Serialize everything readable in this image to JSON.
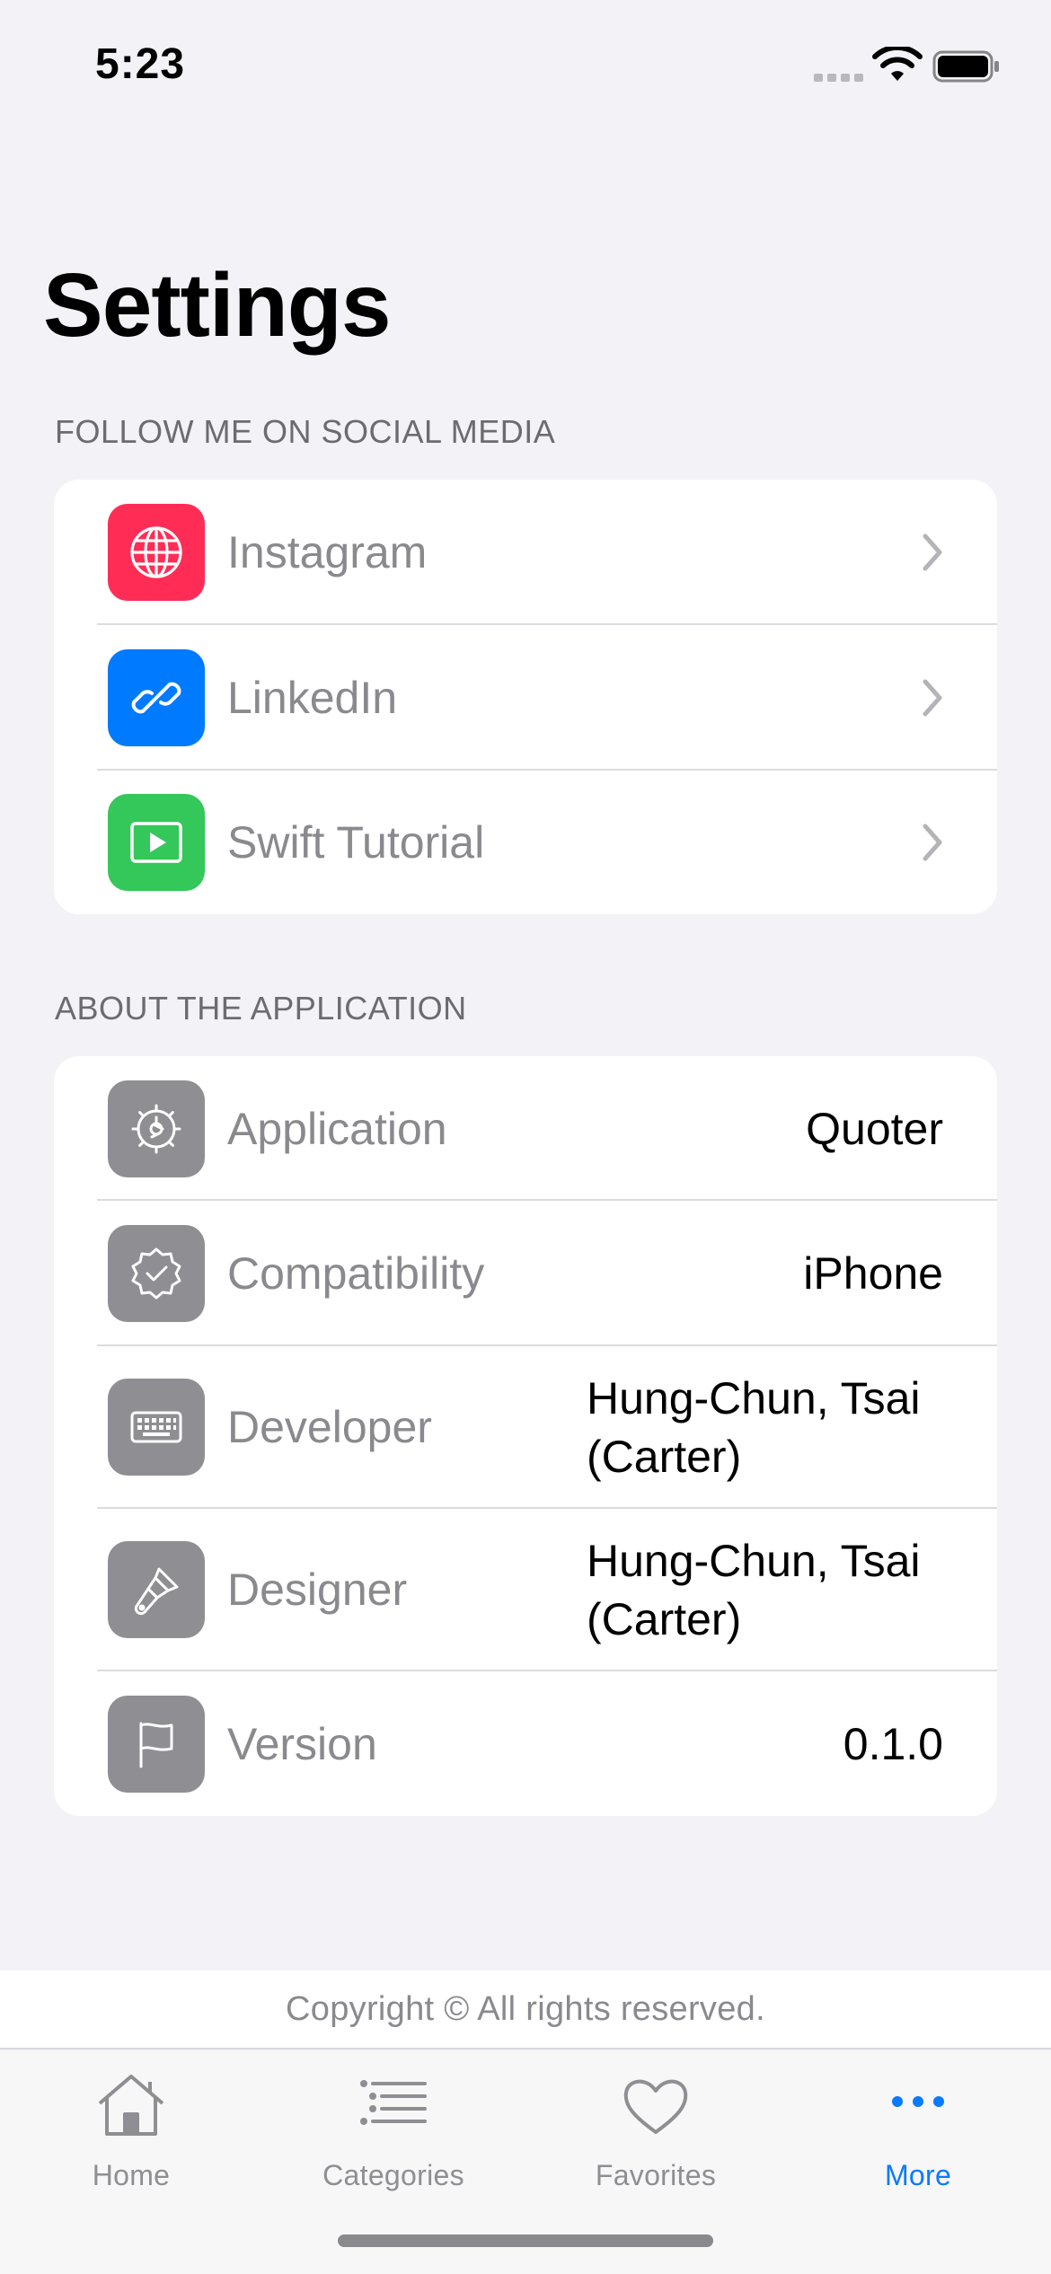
{
  "status_bar": {
    "time": "5:23"
  },
  "title": "Settings",
  "sections": [
    {
      "header": "FOLLOW ME ON SOCIAL MEDIA",
      "rows": [
        {
          "label": "Instagram",
          "icon": "globe-icon",
          "color": "#ff2d55"
        },
        {
          "label": "LinkedIn",
          "icon": "link-icon",
          "color": "#007aff"
        },
        {
          "label": "Swift Tutorial",
          "icon": "play-rectangle-icon",
          "color": "#34c759"
        }
      ]
    },
    {
      "header": "ABOUT THE APPLICATION",
      "rows": [
        {
          "label": "Application",
          "value": "Quoter",
          "icon": "gear-icon",
          "color": "#8e8e93"
        },
        {
          "label": "Compatibility",
          "value": "iPhone",
          "icon": "checkmark-seal-icon",
          "color": "#8e8e93"
        },
        {
          "label": "Developer",
          "value_line1": "Hung-Chun, Tsai",
          "value_line2": "(Carter)",
          "icon": "keyboard-icon",
          "color": "#8e8e93"
        },
        {
          "label": "Designer",
          "value_line1": "Hung-Chun, Tsai",
          "value_line2": "(Carter)",
          "icon": "paintbrush-icon",
          "color": "#8e8e93"
        },
        {
          "label": "Version",
          "value": "0.1.0",
          "icon": "flag-icon",
          "color": "#8e8e93"
        }
      ]
    }
  ],
  "footer": {
    "copyright": "Copyright © All rights reserved."
  },
  "tabs": [
    {
      "label": "Home",
      "icon": "house-icon",
      "active": false
    },
    {
      "label": "Categories",
      "icon": "list-icon",
      "active": false
    },
    {
      "label": "Favorites",
      "icon": "heart-icon",
      "active": false
    },
    {
      "label": "More",
      "icon": "ellipsis-icon",
      "active": true
    }
  ],
  "colors": {
    "accent": "#0a7aff",
    "background": "#f2f2f7"
  }
}
